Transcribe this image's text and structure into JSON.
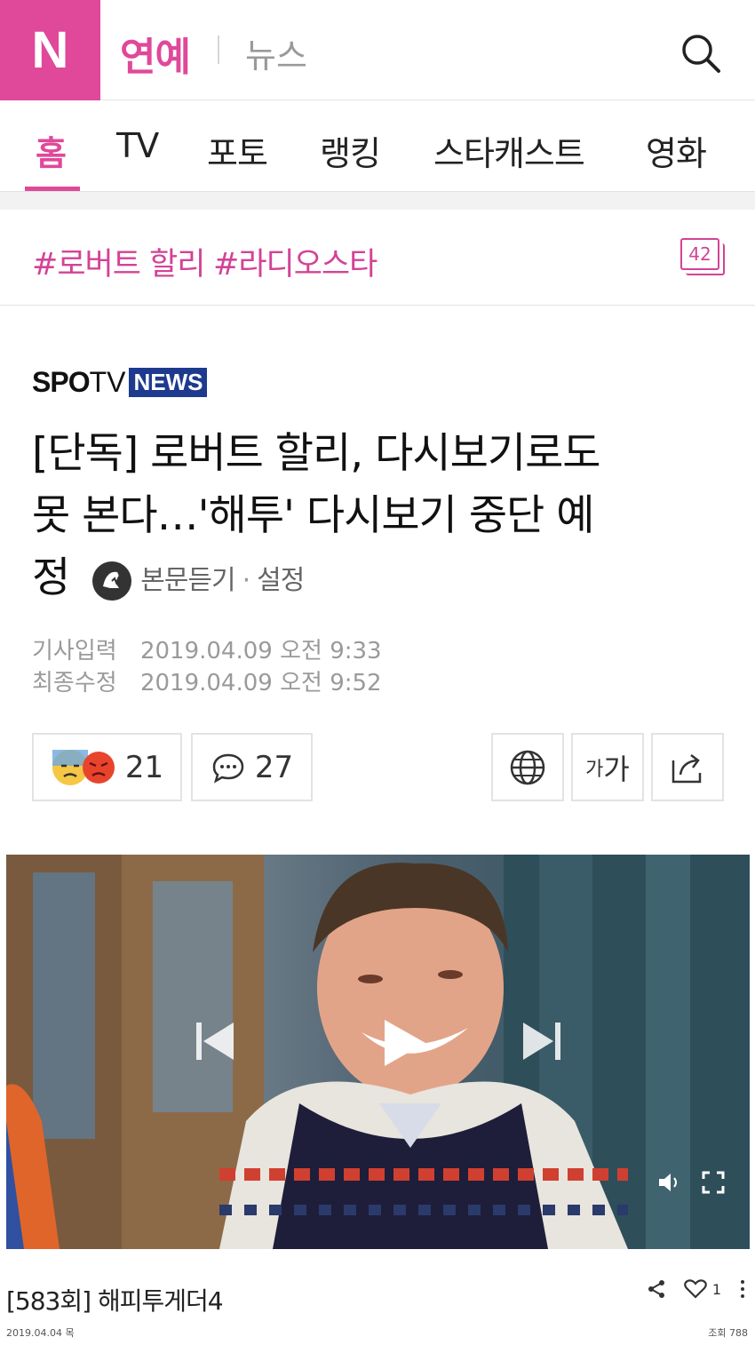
{
  "header": {
    "logo": "N",
    "section_title": "연예",
    "section_sub": "뉴스",
    "accent_color": "#e0489a"
  },
  "tabs": [
    {
      "label": "홈",
      "active": true
    },
    {
      "label": "TV"
    },
    {
      "label": "포토"
    },
    {
      "label": "랭킹"
    },
    {
      "label": "스타캐스트"
    },
    {
      "label": "영화"
    }
  ],
  "hashtags": [
    "#로버트 할리",
    "#라디오스타"
  ],
  "hashtag_count": "42",
  "article": {
    "source_logo": {
      "part1": "SPO",
      "part2": "TV",
      "part3": "NEWS"
    },
    "title_line1": "[단독] 로버트 할리, 다시보기로도",
    "title_line2": "못 본다…'해투' 다시보기 중단 예",
    "title_line3": "정",
    "tts_label": "본문듣기",
    "tts_settings": "설정",
    "published_label": "기사입력",
    "published_value": "2019.04.09 오전 9:33",
    "modified_label": "최종수정",
    "modified_value": "2019.04.09 오전 9:52"
  },
  "actions": {
    "reaction_count": "21",
    "comment_count": "27",
    "font_size_label_small": "가",
    "font_size_label_large": "가"
  },
  "video": {
    "title": "[583회] 해피투게더4",
    "date": "2019.04.04 목",
    "views": "조회 788",
    "like_count": "1"
  }
}
